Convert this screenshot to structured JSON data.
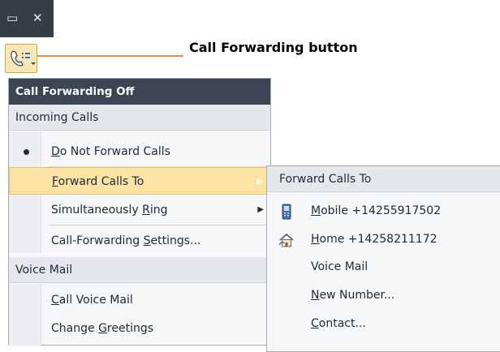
{
  "window_controls": {
    "restore_glyph": "▭",
    "close_glyph": "✕"
  },
  "callout": {
    "label": "Call Forwarding button"
  },
  "colors": {
    "accent": "#f0893a",
    "highlight": "#fde3a3",
    "header_bg": "#3b4553"
  },
  "menu": {
    "header": "Call Forwarding Off",
    "sections": {
      "incoming": "Incoming Calls",
      "voicemail": "Voice Mail"
    },
    "items": {
      "do_not_forward": {
        "pre": "",
        "key": "D",
        "post": "o Not Forward Calls",
        "checked": true
      },
      "forward_calls_to": {
        "pre": "",
        "key": "F",
        "post": "orward Calls To"
      },
      "simultaneously_ring": {
        "pre": "Simultaneously ",
        "key": "R",
        "post": "ing"
      },
      "settings": {
        "pre": "Call-Forwarding ",
        "key": "S",
        "post": "ettings..."
      },
      "call_voice_mail": {
        "pre": "",
        "key": "C",
        "post": "all Voice Mail"
      },
      "change_greetings": {
        "pre": "Change ",
        "key": "G",
        "post": "reetings"
      }
    }
  },
  "submenu": {
    "header": "Forward Calls To",
    "items": {
      "mobile": {
        "pre": "",
        "key": "M",
        "post": "obile +14255917502",
        "icon": "mobile-phone-icon"
      },
      "home": {
        "pre": "",
        "key": "H",
        "post": "ome +14258211172",
        "icon": "home-icon"
      },
      "voice_mail": {
        "label": "Voice Mail"
      },
      "new_number": {
        "pre": "",
        "key": "N",
        "post": "ew Number..."
      },
      "contact": {
        "pre": "",
        "key": "C",
        "post": "ontact..."
      }
    }
  }
}
